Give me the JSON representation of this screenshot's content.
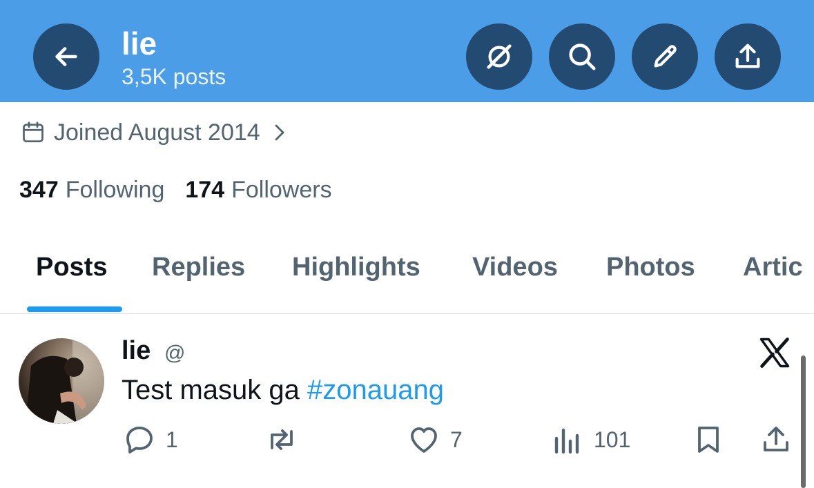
{
  "header": {
    "name": "lie",
    "post_count": "3,5K posts",
    "icons": [
      "back-arrow-icon",
      "grok-icon",
      "search-icon",
      "pencil-icon",
      "share-icon"
    ]
  },
  "profile": {
    "joined": "Joined August 2014",
    "following_count": "347",
    "following_label": "Following",
    "followers_count": "174",
    "followers_label": "Followers"
  },
  "tabs": [
    {
      "label": "Posts",
      "active": true
    },
    {
      "label": "Replies",
      "active": false
    },
    {
      "label": "Highlights",
      "active": false
    },
    {
      "label": "Videos",
      "active": false
    },
    {
      "label": "Photos",
      "active": false
    },
    {
      "label": "Artic",
      "active": false
    }
  ],
  "post": {
    "author": "lie",
    "handle": "@",
    "text": "Test masuk ga ",
    "hashtag": "#zonauang",
    "replies": "1",
    "likes": "7",
    "views": "101"
  },
  "colors": {
    "header_bg": "#4a9de6",
    "header_button": "#234a70",
    "accent": "#1d9bf0",
    "muted_text": "#536471"
  }
}
